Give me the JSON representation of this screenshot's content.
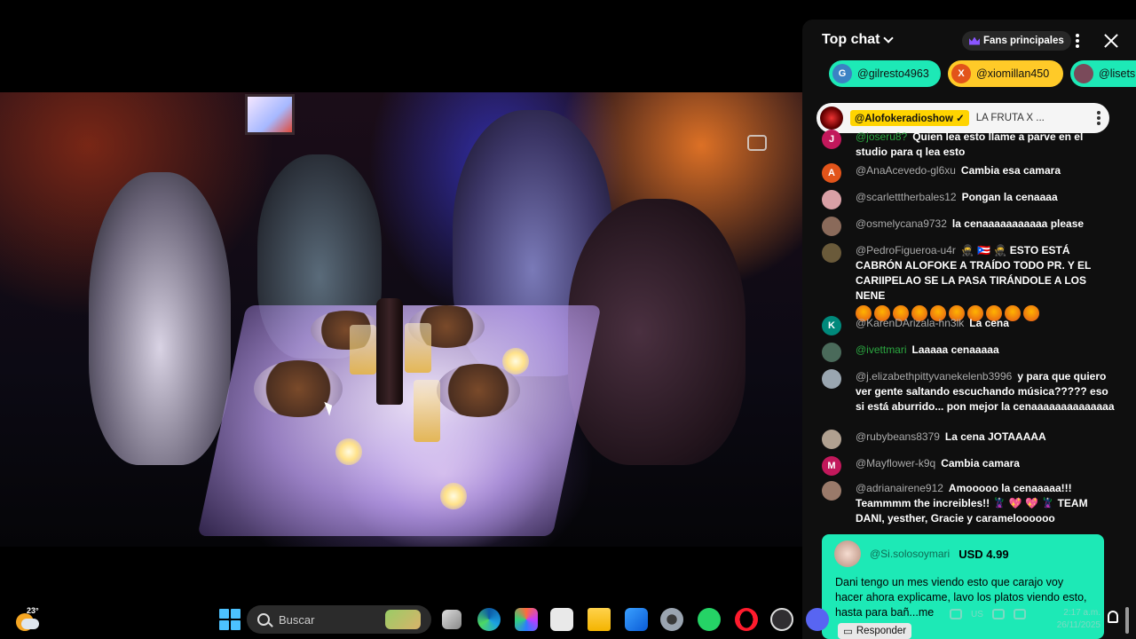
{
  "video": {},
  "chat": {
    "header": {
      "title": "Top chat",
      "fans_label": "Fans principales"
    },
    "tickers": [
      {
        "initial": "G",
        "name": "@gilresto4963",
        "bg": "#1de9b6",
        "avatar_bg": "#3b82c4"
      },
      {
        "initial": "X",
        "name": "@xiomillan450",
        "bg": "#ffca28",
        "avatar_bg": "#e2541a"
      },
      {
        "initial": "",
        "name": "@lisets",
        "bg": "#1de9b6",
        "avatar_bg": "#7a4a5a"
      }
    ],
    "pinned": {
      "channel": "@Alofokeradioshow ✓",
      "text": "LA FRUTA X ..."
    },
    "messages": [
      {
        "initial": "J",
        "avatar_bg": "#c2185b",
        "author": "@joseru8?",
        "text": "Quien lea esto llame a parve en el studio para q lea esto"
      },
      {
        "initial": "A",
        "avatar_bg": "#e2541a",
        "author": "@AnaAcevedo-gl6xu",
        "text": "Cambia esa camara"
      },
      {
        "initial": "",
        "avatar_bg": "#d9a0a6",
        "author": "@scarletttherbales12",
        "text": "Pongan la cenaaaa"
      },
      {
        "initial": "",
        "avatar_bg": "#8a6a5a",
        "author": "@osmelycana9732",
        "text": "la cenaaaaaaaaaaa please"
      },
      {
        "initial": "",
        "avatar_bg": "#6a5a3a",
        "author": "@PedroFigueroa-u4r",
        "text": "🥷 🇵🇷 🥷 ESTO ESTÁ CABRÓN ALOFOKE A TRAÍDO TODO PR. Y EL CARIIPELAO SE LA PASA TIRÁNDOLE A LOS NENE"
      },
      {
        "initial": "K",
        "avatar_bg": "#00897b",
        "author": "@KarenDArizala-hn3lk",
        "text": "La cena"
      },
      {
        "initial": "",
        "avatar_bg": "#4a6a5a",
        "author": "@ivettmari",
        "text": "Laaaaa cenaaaaa"
      },
      {
        "initial": "",
        "avatar_bg": "#9aa6b0",
        "author": "@j.elizabethpittyvanekelenb3996",
        "text": "y para que quiero ver gente saltando escuchando música????? eso si está aburrido... pon mejor la cenaaaaaaaaaaaaaa"
      },
      {
        "initial": "",
        "avatar_bg": "#b0a090",
        "author": "@rubybeans8379",
        "text": "La cena JOTAAAAA"
      },
      {
        "initial": "M",
        "avatar_bg": "#c2185b",
        "author": "@Mayflower-k9q",
        "text": "Cambia camara"
      },
      {
        "initial": "",
        "avatar_bg": "#9a7a6a",
        "author": "@adrianairene912",
        "text": "Amooooo la cenaaaaa!!! Teammmm the increibles!! 🦹 💖 💖 🦹 TEAM DANI, yesther, Gracie y carameloooooo"
      }
    ],
    "superchat": {
      "author": "@Si.solosoymari",
      "amount": "USD 4.99",
      "text": "Dani tengo un mes viendo esto que carajo voy hacer ahora explicame, lavo los platos viendo esto, hasta para bañ...me",
      "reply_label": "Responder"
    }
  },
  "taskbar": {
    "weather_temp": "23°",
    "search_placeholder": "Buscar",
    "lang": "US",
    "time": "2:17 a.m.",
    "date": "26/11/2025"
  },
  "colors": {
    "member": "#2ba640",
    "superchat": "#1de9b6",
    "accent": "#3ea6ff"
  }
}
